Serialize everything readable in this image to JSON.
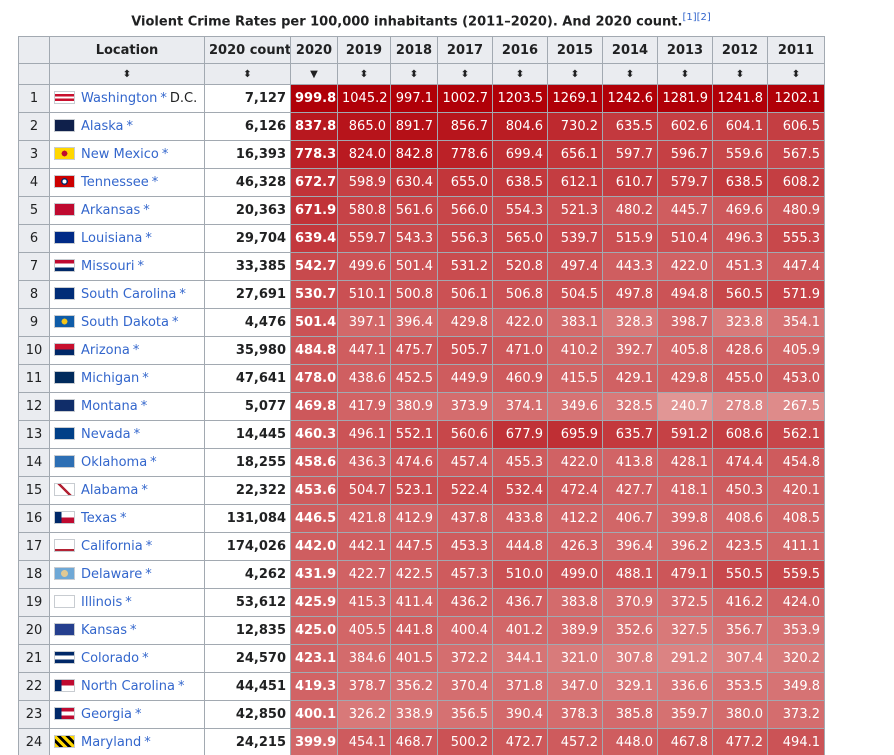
{
  "caption": {
    "title": "Violent Crime Rates per 100,000 inhabitants (2011–2020). And 2020 count.",
    "refs": "[1][2]"
  },
  "headers": [
    "",
    "Location",
    "2020 count",
    "2020",
    "2019",
    "2018",
    "2017",
    "2016",
    "2015",
    "2014",
    "2013",
    "2012",
    "2011"
  ],
  "sort_icons": [
    "",
    "⬍",
    "⬍",
    "▼",
    "⬍",
    "⬍",
    "⬍",
    "⬍",
    "⬍",
    "⬍",
    "⬍",
    "⬍",
    "⬍"
  ],
  "colors": {
    "header_bg": "#eaecf0",
    "link": "#3366cc",
    "border": "#a2a9b1"
  },
  "rows": [
    {
      "rank": "1",
      "name": "Washington",
      "suffix": "D.C.",
      "flag": "dc-flag",
      "count": "7,127",
      "values": [
        "999.8",
        "1045.2",
        "997.1",
        "1002.7",
        "1203.5",
        "1269.1",
        "1242.6",
        "1281.9",
        "1241.8",
        "1202.1"
      ]
    },
    {
      "rank": "2",
      "name": "Alaska",
      "suffix": "",
      "flag": "alaska-flag",
      "count": "6,126",
      "values": [
        "837.8",
        "865.0",
        "891.7",
        "856.7",
        "804.6",
        "730.2",
        "635.5",
        "602.6",
        "604.1",
        "606.5"
      ]
    },
    {
      "rank": "3",
      "name": "New Mexico",
      "suffix": "",
      "flag": "new-mexico-flag",
      "count": "16,393",
      "values": [
        "778.3",
        "824.0",
        "842.8",
        "778.6",
        "699.4",
        "656.1",
        "597.7",
        "596.7",
        "559.6",
        "567.5"
      ]
    },
    {
      "rank": "4",
      "name": "Tennessee",
      "suffix": "",
      "flag": "tennessee-flag",
      "count": "46,328",
      "values": [
        "672.7",
        "598.9",
        "630.4",
        "655.0",
        "638.5",
        "612.1",
        "610.7",
        "579.7",
        "638.5",
        "608.2"
      ]
    },
    {
      "rank": "5",
      "name": "Arkansas",
      "suffix": "",
      "flag": "arkansas-flag",
      "count": "20,363",
      "values": [
        "671.9",
        "580.8",
        "561.6",
        "566.0",
        "554.3",
        "521.3",
        "480.2",
        "445.7",
        "469.6",
        "480.9"
      ]
    },
    {
      "rank": "6",
      "name": "Louisiana",
      "suffix": "",
      "flag": "louisiana-flag",
      "count": "29,704",
      "values": [
        "639.4",
        "559.7",
        "543.3",
        "556.3",
        "565.0",
        "539.7",
        "515.9",
        "510.4",
        "496.3",
        "555.3"
      ]
    },
    {
      "rank": "7",
      "name": "Missouri",
      "suffix": "",
      "flag": "missouri-flag",
      "count": "33,385",
      "values": [
        "542.7",
        "499.6",
        "501.4",
        "531.2",
        "520.8",
        "497.4",
        "443.3",
        "422.0",
        "451.3",
        "447.4"
      ]
    },
    {
      "rank": "8",
      "name": "South Carolina",
      "suffix": "",
      "flag": "south-carolina-flag",
      "count": "27,691",
      "values": [
        "530.7",
        "510.1",
        "500.8",
        "506.1",
        "506.8",
        "504.5",
        "497.8",
        "494.8",
        "560.5",
        "571.9"
      ]
    },
    {
      "rank": "9",
      "name": "South Dakota",
      "suffix": "",
      "flag": "south-dakota-flag",
      "count": "4,476",
      "values": [
        "501.4",
        "397.1",
        "396.4",
        "429.8",
        "422.0",
        "383.1",
        "328.3",
        "398.7",
        "323.8",
        "354.1"
      ]
    },
    {
      "rank": "10",
      "name": "Arizona",
      "suffix": "",
      "flag": "arizona-flag",
      "count": "35,980",
      "values": [
        "484.8",
        "447.1",
        "475.7",
        "505.7",
        "471.0",
        "410.2",
        "392.7",
        "405.8",
        "428.6",
        "405.9"
      ]
    },
    {
      "rank": "11",
      "name": "Michigan",
      "suffix": "",
      "flag": "michigan-flag",
      "count": "47,641",
      "values": [
        "478.0",
        "438.6",
        "452.5",
        "449.9",
        "460.9",
        "415.5",
        "429.1",
        "429.8",
        "455.0",
        "453.0"
      ]
    },
    {
      "rank": "12",
      "name": "Montana",
      "suffix": "",
      "flag": "montana-flag",
      "count": "5,077",
      "values": [
        "469.8",
        "417.9",
        "380.9",
        "373.9",
        "374.1",
        "349.6",
        "328.5",
        "240.7",
        "278.8",
        "267.5"
      ]
    },
    {
      "rank": "13",
      "name": "Nevada",
      "suffix": "",
      "flag": "nevada-flag",
      "count": "14,445",
      "values": [
        "460.3",
        "496.1",
        "552.1",
        "560.6",
        "677.9",
        "695.9",
        "635.7",
        "591.2",
        "608.6",
        "562.1"
      ]
    },
    {
      "rank": "14",
      "name": "Oklahoma",
      "suffix": "",
      "flag": "oklahoma-flag",
      "count": "18,255",
      "values": [
        "458.6",
        "436.3",
        "474.6",
        "457.4",
        "455.3",
        "422.0",
        "413.8",
        "428.1",
        "474.4",
        "454.8"
      ]
    },
    {
      "rank": "15",
      "name": "Alabama",
      "suffix": "",
      "flag": "alabama-flag",
      "count": "22,322",
      "values": [
        "453.6",
        "504.7",
        "523.1",
        "522.4",
        "532.4",
        "472.4",
        "427.7",
        "418.1",
        "450.3",
        "420.1"
      ]
    },
    {
      "rank": "16",
      "name": "Texas",
      "suffix": "",
      "flag": "texas-flag",
      "count": "131,084",
      "values": [
        "446.5",
        "421.8",
        "412.9",
        "437.8",
        "433.8",
        "412.2",
        "406.7",
        "399.8",
        "408.6",
        "408.5"
      ]
    },
    {
      "rank": "17",
      "name": "California",
      "suffix": "",
      "flag": "california-flag",
      "count": "174,026",
      "values": [
        "442.0",
        "442.1",
        "447.5",
        "453.3",
        "444.8",
        "426.3",
        "396.4",
        "396.2",
        "423.5",
        "411.1"
      ]
    },
    {
      "rank": "18",
      "name": "Delaware",
      "suffix": "",
      "flag": "delaware-flag",
      "count": "4,262",
      "values": [
        "431.9",
        "422.7",
        "422.5",
        "457.3",
        "510.0",
        "499.0",
        "488.1",
        "479.1",
        "550.5",
        "559.5"
      ]
    },
    {
      "rank": "19",
      "name": "Illinois",
      "suffix": "",
      "flag": "illinois-flag",
      "count": "53,612",
      "values": [
        "425.9",
        "415.3",
        "411.4",
        "436.2",
        "436.7",
        "383.8",
        "370.9",
        "372.5",
        "416.2",
        "424.0"
      ]
    },
    {
      "rank": "20",
      "name": "Kansas",
      "suffix": "",
      "flag": "kansas-flag",
      "count": "12,835",
      "values": [
        "425.0",
        "405.5",
        "441.8",
        "400.4",
        "401.2",
        "389.9",
        "352.6",
        "327.5",
        "356.7",
        "353.9"
      ]
    },
    {
      "rank": "21",
      "name": "Colorado",
      "suffix": "",
      "flag": "colorado-flag",
      "count": "24,570",
      "values": [
        "423.1",
        "384.6",
        "401.5",
        "372.2",
        "344.1",
        "321.0",
        "307.8",
        "291.2",
        "307.4",
        "320.2"
      ]
    },
    {
      "rank": "22",
      "name": "North Carolina",
      "suffix": "",
      "flag": "north-carolina-flag",
      "count": "44,451",
      "values": [
        "419.3",
        "378.7",
        "356.2",
        "370.4",
        "371.8",
        "347.0",
        "329.1",
        "336.6",
        "353.5",
        "349.8"
      ]
    },
    {
      "rank": "23",
      "name": "Georgia",
      "suffix": "",
      "flag": "georgia-flag",
      "count": "42,850",
      "values": [
        "400.1",
        "326.2",
        "338.9",
        "356.5",
        "390.4",
        "378.3",
        "385.8",
        "359.7",
        "380.0",
        "373.2"
      ]
    },
    {
      "rank": "24",
      "name": "Maryland",
      "suffix": "",
      "flag": "maryland-flag",
      "count": "24,215",
      "values": [
        "399.9",
        "454.1",
        "468.7",
        "500.2",
        "472.7",
        "457.2",
        "448.0",
        "467.8",
        "477.2",
        "494.1"
      ]
    }
  ]
}
